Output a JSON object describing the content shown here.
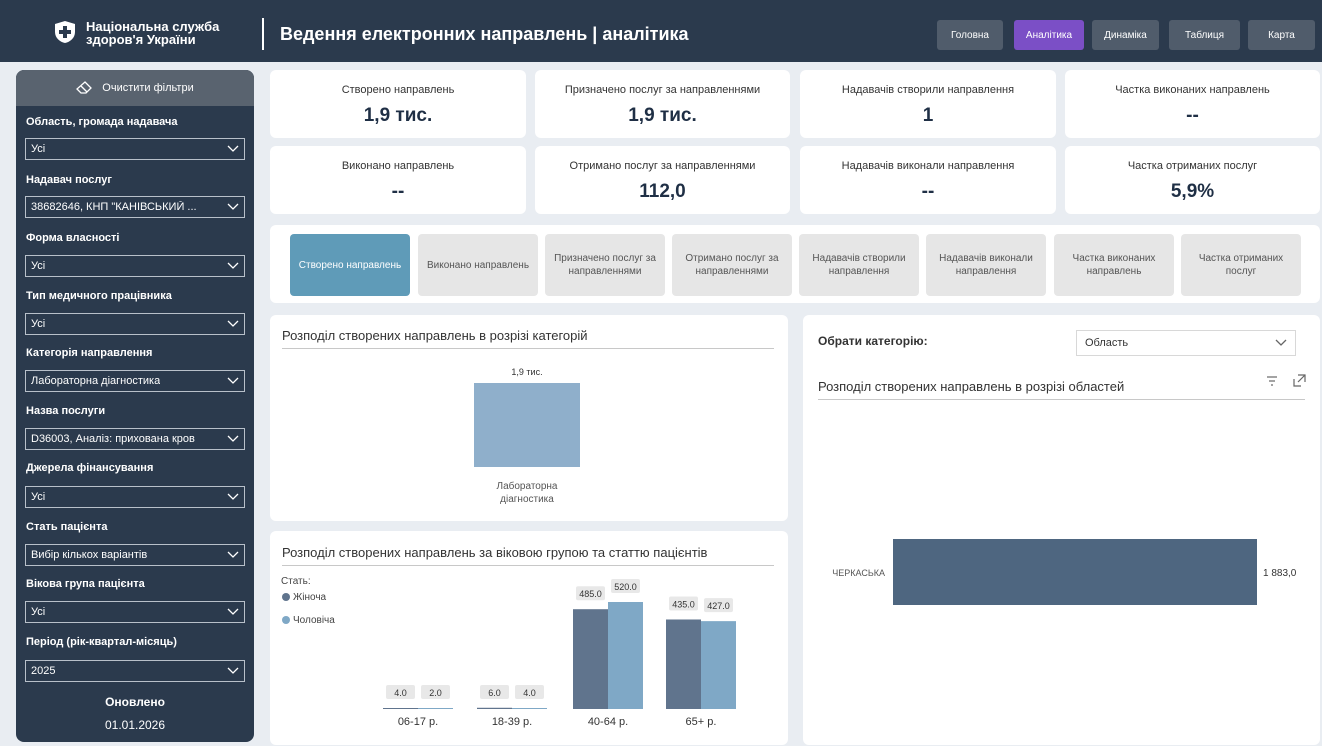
{
  "header": {
    "org_name": "Національна служба здоров'я України",
    "title": "Ведення електронних направлень | аналітика",
    "nav": [
      {
        "label": "Головна",
        "active": false
      },
      {
        "label": "Аналітика",
        "active": true
      },
      {
        "label": "Динаміка",
        "active": false
      },
      {
        "label": "Таблиця",
        "active": false
      },
      {
        "label": "Карта",
        "active": false
      }
    ]
  },
  "sidebar": {
    "clear_label": "Очистити фільтри",
    "filters": [
      {
        "label": "Область, громада надавача",
        "value": "Усі"
      },
      {
        "label": "Надавач послуг",
        "value": "38682646, КНП \"КАНІВСЬКИЙ ..."
      },
      {
        "label": "Форма власності",
        "value": "Усі"
      },
      {
        "label": "Тип медичного працівника",
        "value": "Усі"
      },
      {
        "label": "Категорія направлення",
        "value": "Лабораторна діагностика"
      },
      {
        "label": "Назва послуги",
        "value": "D36003, Аналіз: прихована кров"
      },
      {
        "label": "Джерела фінансування",
        "value": "Усі"
      },
      {
        "label": "Стать пацієнта",
        "value": "Вибір кількох варіантів"
      },
      {
        "label": "Вікова група пацієнта",
        "value": "Усі"
      },
      {
        "label": "Період (рік-квартал-місяць)",
        "value": "2025"
      }
    ],
    "updated_label": "Оновлено",
    "updated_date": "01.01.2026"
  },
  "kpis": [
    {
      "label": "Створено направлень",
      "value": "1,9 тис."
    },
    {
      "label": "Призначено послуг за направленнями",
      "value": "1,9 тис."
    },
    {
      "label": "Надавачів створили направлення",
      "value": "1"
    },
    {
      "label": "Частка виконаних направлень",
      "value": "--"
    },
    {
      "label": "Виконано направлень",
      "value": "--"
    },
    {
      "label": "Отримано послуг за направленнями",
      "value": "112,0"
    },
    {
      "label": "Надавачів виконали направлення",
      "value": "--"
    },
    {
      "label": "Частка отриманих послуг",
      "value": "5,9%"
    }
  ],
  "tabs": [
    {
      "label": "Створено направлень",
      "active": true
    },
    {
      "label": "Виконано направлень",
      "active": false
    },
    {
      "label": "Призначено послуг за направленнями",
      "active": false
    },
    {
      "label": "Отримано послуг за направленнями",
      "active": false
    },
    {
      "label": "Надавачів створили направлення",
      "active": false
    },
    {
      "label": "Надавачів виконали направлення",
      "active": false
    },
    {
      "label": "Частка виконаних направлень",
      "active": false
    },
    {
      "label": "Частка отриманих послуг",
      "active": false
    }
  ],
  "category_picker": {
    "label": "Обрати категорію:",
    "value": "Область"
  },
  "colors": {
    "accent": "#7b4fc6",
    "female": "#60748d",
    "male": "#7fa8c6",
    "category_bar": "#8fafcb",
    "region_bar": "#4e6680"
  },
  "chart_data": [
    {
      "type": "bar",
      "title": "Розподіл створених направлень в розрізі категорій",
      "categories": [
        "Лабораторна діагностика"
      ],
      "values": [
        1883
      ],
      "data_labels": [
        "1,9 тис."
      ]
    },
    {
      "type": "bar",
      "title": "Розподіл створених направлень за віковою групою та статтю пацієнтів",
      "legend_title": "Стать:",
      "legend_position": "top-left",
      "categories": [
        "06-17 р.",
        "18-39 р.",
        "40-64 р.",
        "65+ р."
      ],
      "series": [
        {
          "name": "Жіноча",
          "values": [
            4.0,
            6.0,
            485.0,
            435.0
          ],
          "labels": [
            "4.0",
            "6.0",
            "485.0",
            "435.0"
          ]
        },
        {
          "name": "Чоловіча",
          "values": [
            2.0,
            4.0,
            520.0,
            427.0
          ],
          "labels": [
            "2.0",
            "4.0",
            "520.0",
            "427.0"
          ]
        }
      ]
    },
    {
      "type": "bar",
      "orientation": "horizontal",
      "title": "Розподіл створених направлень в розрізі областей",
      "categories": [
        "ЧЕРКАСЬКА"
      ],
      "values": [
        1883.0
      ],
      "data_labels": [
        "1 883,0"
      ]
    }
  ]
}
